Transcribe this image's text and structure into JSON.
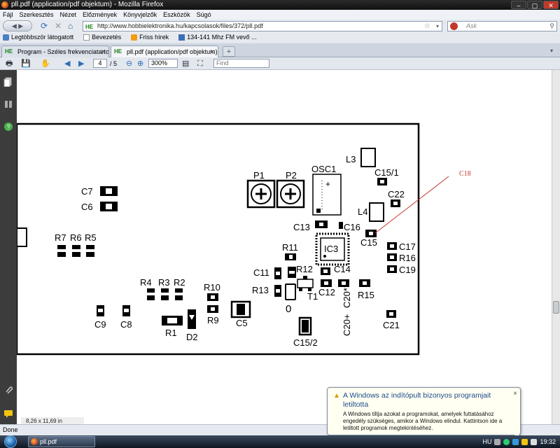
{
  "window": {
    "title": "pll.pdf (application/pdf objektum) - Mozilla Firefox",
    "controls": [
      "–",
      "▢",
      "✕"
    ]
  },
  "menu": [
    "Fájl",
    "Szerkesztés",
    "Nézet",
    "Előzmények",
    "Könyvjelzők",
    "Eszközök",
    "Súgó"
  ],
  "navigation": {
    "back_forward": "◀ ▶",
    "favicon_label": "HE",
    "url": "http://www.hobbielektronika.hu/kapcsolasok/files/372/pll.pdf",
    "search_placeholder": "Ask",
    "icons": [
      "back-forward-icon",
      "reload-icon",
      "stop-icon",
      "home-icon",
      "bookmark-star-icon",
      "search-engine-icon",
      "magnifier-icon"
    ]
  },
  "bookmarks": [
    {
      "label": "Legtöbbször látogatott",
      "icon": "bookmark-icon",
      "color": "#4a7fc1"
    },
    {
      "label": "Bevezetés",
      "icon": "page-icon",
      "color": "#ffffff"
    },
    {
      "label": "Friss hírek",
      "icon": "rss-icon",
      "color": "#f39c12"
    },
    {
      "label": "134-141 Mhz FM vevő ...",
      "icon": "folder-icon",
      "color": "#3b6fb6"
    }
  ],
  "tabs": [
    {
      "label": "Program - Széles frekvenciatartomá...",
      "favicon": "HE",
      "active": false
    },
    {
      "label": "pll.pdf (application/pdf objektum)",
      "favicon": "HE",
      "active": true
    }
  ],
  "tab_controls": {
    "new_tab": "+",
    "list": "▾"
  },
  "pdf_toolbar": {
    "page": "4",
    "page_total": "/ 5",
    "zoom": "300%",
    "find_placeholder": "Find"
  },
  "pdf_sidebar_icons": [
    "pages-icon",
    "bookmarks-icon",
    "help-icon",
    "attachment-icon",
    "comment-icon"
  ],
  "pcb": {
    "component_labels": [
      "C7",
      "C6",
      "R7",
      "R6",
      "R5",
      "P1",
      "P2",
      "OSC1",
      "L3",
      "C15/1",
      "C22",
      "L4",
      "C13",
      "C16",
      "C15",
      "C17",
      "R16",
      "C19",
      "IC3",
      "R11",
      "C11",
      "R12",
      "C14",
      "R13",
      "T1",
      "C12",
      "C20*",
      "C20+",
      "R15",
      "R4",
      "R3",
      "R2",
      "R10",
      "R9",
      "C9",
      "C8",
      "R1",
      "D2",
      "C5",
      "C15/2",
      "C21",
      "0"
    ],
    "annotation": "C18",
    "annotation_color": "#c0392b"
  },
  "status": {
    "text": "Done",
    "page_size": "8,26 x 11,69 in"
  },
  "notification": {
    "title": "A Windows az indítópult bizonyos programjait letiltotta",
    "body": "A Windows tiltja azokat a programokat, amelyek futtatásához engedély szükséges, amikor a Windows elindul. Kattintson ide a letiltott programok megtekintéséhez.",
    "close": "×",
    "icon": "warning-icon"
  },
  "taskbar": {
    "item": "pll.pdf (application/...",
    "language": "HU",
    "clock": "19:32"
  }
}
